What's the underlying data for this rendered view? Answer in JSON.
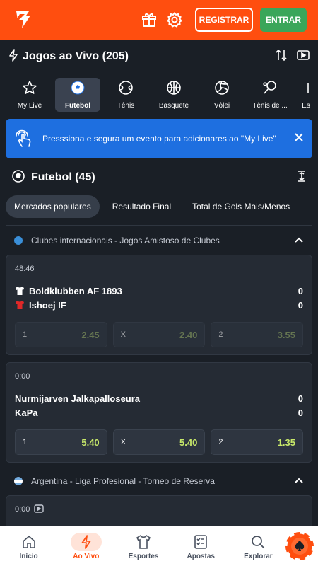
{
  "header": {
    "register_label": "REGISTRAR",
    "enter_label": "ENTRAR"
  },
  "live": {
    "title": "Jogos ao Vivo (205)"
  },
  "sports_tabs": [
    {
      "label": "My Live",
      "icon": "star-icon",
      "active": false
    },
    {
      "label": "Futebol",
      "icon": "soccer-ball-icon",
      "active": true
    },
    {
      "label": "Tênis",
      "icon": "tennis-ball-icon",
      "active": false
    },
    {
      "label": "Basquete",
      "icon": "basketball-icon",
      "active": false
    },
    {
      "label": "Vôlei",
      "icon": "volleyball-icon",
      "active": false
    },
    {
      "label": "Tênis de ...",
      "icon": "table-tennis-icon",
      "active": false
    },
    {
      "label": "Es",
      "icon": "esports-icon",
      "active": false
    }
  ],
  "banner": {
    "text": "Presssiona e segura um evento para adicionares ao \"My Live\""
  },
  "section": {
    "title": "Futebol (45)"
  },
  "market_tabs": [
    {
      "label": "Mercados populares",
      "active": true
    },
    {
      "label": "Resultado Final",
      "active": false
    },
    {
      "label": "Total de Gols Mais/Menos",
      "active": false
    }
  ],
  "leagues": [
    {
      "name": "Clubes internacionais - Jogos Amistoso de Clubes",
      "flag_color": "#3a8fd8"
    },
    {
      "name": "Argentina - Liga Profesional - Torneo de Reserva",
      "flag_color": "#74acdf"
    }
  ],
  "events": [
    {
      "time": "48:46",
      "home": {
        "name": "Boldklubben AF 1893",
        "score": "0",
        "shirt_color": "#ffffff"
      },
      "away": {
        "name": "Ishoej IF",
        "score": "0",
        "shirt_color": "#e02828"
      },
      "odds": [
        {
          "label": "1",
          "value": "2.45"
        },
        {
          "label": "X",
          "value": "2.40"
        },
        {
          "label": "2",
          "value": "3.55"
        }
      ]
    },
    {
      "time": "0:00",
      "home": {
        "name": "Nurmijarven Jalkapalloseura",
        "score": "0"
      },
      "away": {
        "name": "KaPa",
        "score": "0"
      },
      "odds": [
        {
          "label": "1",
          "value": "5.40"
        },
        {
          "label": "X",
          "value": "5.40"
        },
        {
          "label": "2",
          "value": "1.35"
        }
      ]
    },
    {
      "time": "0:00"
    }
  ],
  "bottom_nav": [
    {
      "label": "Início",
      "icon": "home-icon",
      "active": false
    },
    {
      "label": "Ao Vivo",
      "icon": "lightning-icon",
      "active": true
    },
    {
      "label": "Esportes",
      "icon": "shirt-icon",
      "active": false
    },
    {
      "label": "Apostas",
      "icon": "betslip-icon",
      "active": false
    },
    {
      "label": "Explorar",
      "icon": "search-icon",
      "active": false
    }
  ],
  "colors": {
    "brand": "#ff4e0f",
    "enter": "#3aa65a",
    "banner": "#1e6fe0",
    "odds": "#c7e86a"
  }
}
